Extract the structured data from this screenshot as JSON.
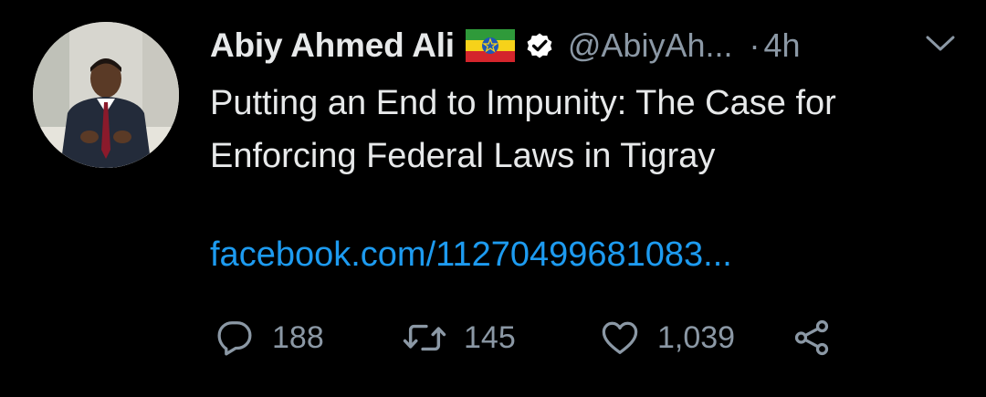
{
  "author": {
    "name": "Abiy Ahmed Ali",
    "handle": "@AbiyAh...",
    "separator": "·",
    "time": "4h"
  },
  "tweet": {
    "line1": "Putting an End to Impunity: The Case for",
    "line2": "Enforcing Federal Laws in Tigray",
    "link": "facebook.com/11270499681083..."
  },
  "actions": {
    "replies": "188",
    "retweets": "145",
    "likes": "1,039"
  },
  "icons": {
    "flag": "ethiopia-flag-icon",
    "verified": "verified-badge-icon",
    "more": "chevron-down-icon",
    "reply": "reply-icon",
    "retweet": "retweet-icon",
    "like": "heart-icon",
    "share": "share-icon"
  },
  "colors": {
    "background": "#000000",
    "text": "#e7e9ea",
    "secondary": "#8b98a5",
    "link": "#1d9bf0"
  }
}
